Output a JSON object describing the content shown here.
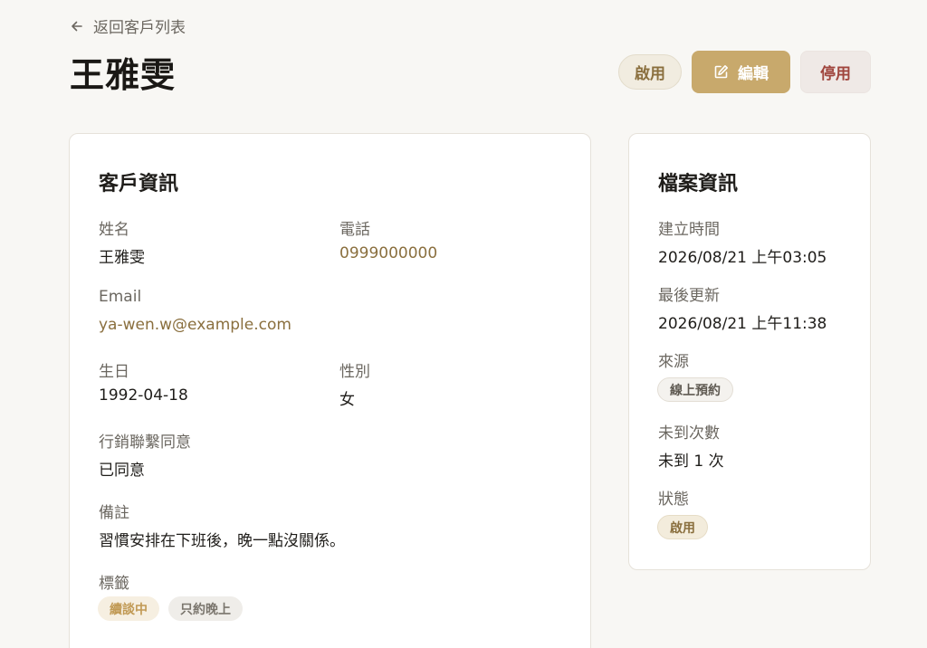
{
  "back": {
    "label": "返回客戶列表"
  },
  "customer": {
    "name": "王雅雯"
  },
  "actions": {
    "enable": "啟用",
    "edit": "編輯",
    "disable": "停用"
  },
  "info": {
    "title": "客戶資訊",
    "name_label": "姓名",
    "name_value": "王雅雯",
    "phone_label": "電話",
    "phone_value": "0999000000",
    "email_label": "Email",
    "email_value": "ya-wen.w@example.com",
    "birthday_label": "生日",
    "birthday_value": "1992-04-18",
    "gender_label": "性別",
    "gender_value": "女",
    "marketing_label": "行銷聯繫同意",
    "marketing_value": "已同意",
    "note_label": "備註",
    "note_value": "習慣安排在下班後，晚一點沒關係。",
    "tags_label": "標籤",
    "tags": [
      "續談中",
      "只約晚上"
    ]
  },
  "record": {
    "title": "檔案資訊",
    "created_label": "建立時間",
    "created_value": "2026/08/21 上午03:05",
    "updated_label": "最後更新",
    "updated_value": "2026/08/21 上午11:38",
    "source_label": "來源",
    "source_value": "線上預約",
    "noshow_label": "未到次數",
    "noshow_value": "未到 1 次",
    "status_label": "狀態",
    "status_value": "啟用"
  },
  "icons": {
    "back": "arrow-left-icon",
    "edit": "edit-icon"
  },
  "colors": {
    "accent": "#c8a96c",
    "link": "#8a6f3e",
    "danger": "#a0453d"
  }
}
